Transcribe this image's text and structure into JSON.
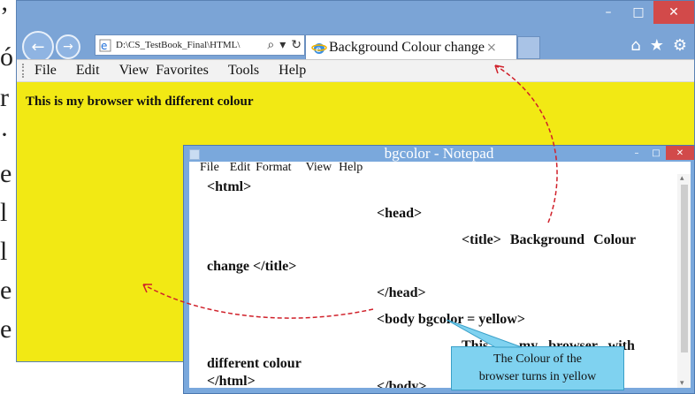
{
  "edge_text": [
    "’",
    "ó",
    "r",
    "·",
    "e",
    "l",
    "l",
    "e",
    "e"
  ],
  "browser": {
    "window_controls": {
      "minimize": "–",
      "maximize": "□",
      "close": "✕"
    },
    "nav": {
      "back": "←",
      "forward": "→"
    },
    "address": {
      "url": "D:\\CS_TestBook_Final\\HTML\\",
      "search_glyph": "⌕",
      "dropdown_glyph": "▾",
      "refresh_glyph": "↻"
    },
    "tab": {
      "title": "Background Colour change",
      "close": "×"
    },
    "tools": {
      "home": "⌂",
      "favorites": "★",
      "settings": "⚙"
    },
    "menu": [
      "File",
      "Edit",
      "View",
      "Favorites",
      "Tools",
      "Help"
    ],
    "page_text": "This is my browser with different colour",
    "page_bg_color": "#f2e914"
  },
  "notepad": {
    "title": "bgcolor - Notepad",
    "controls": {
      "minimize": "–",
      "maximize": "□",
      "close": "✕"
    },
    "menu": [
      "File",
      "Edit",
      "Format",
      "View",
      "Help"
    ],
    "lines": {
      "html_open": "<html>",
      "head_open": "<head>",
      "title_part1": "<title> Background Colour",
      "title_part2": "change </title>",
      "head_close": "</head>",
      "body_open": "<body bgcolor = yellow>",
      "text_part1": "This is my browser with",
      "text_part2": "different colour",
      "body_close": "</body>",
      "html_close": "</html>"
    },
    "scroll_up": "▴",
    "scroll_down": "▾"
  },
  "callout": {
    "line1": "The Colour of the",
    "line2": "browser turns in yellow"
  },
  "colors": {
    "accent_arrow": "#d0202a",
    "callout_bg": "#7fd2f0"
  }
}
